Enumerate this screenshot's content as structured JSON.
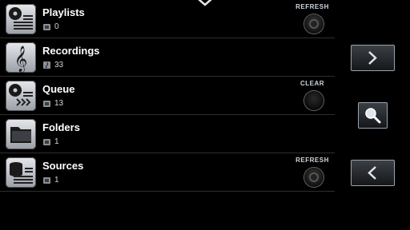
{
  "rows": [
    {
      "title": "Playlists",
      "count": "0",
      "icon": "playlist-disc-icon",
      "action": "REFRESH"
    },
    {
      "title": "Recordings",
      "count": "33",
      "icon": "treble-clef-icon",
      "action": ""
    },
    {
      "title": "Queue",
      "count": "13",
      "icon": "queue-disc-icon",
      "action": "CLEAR"
    },
    {
      "title": "Folders",
      "count": "1",
      "icon": "folder-icon",
      "action": ""
    },
    {
      "title": "Sources",
      "count": "1",
      "icon": "database-stack-icon",
      "action": "REFRESH"
    }
  ],
  "nav": {
    "collapse": "chevron-down-icon",
    "forward": "chevron-right-icon",
    "search": "magnifier-icon",
    "back": "chevron-left-icon"
  }
}
